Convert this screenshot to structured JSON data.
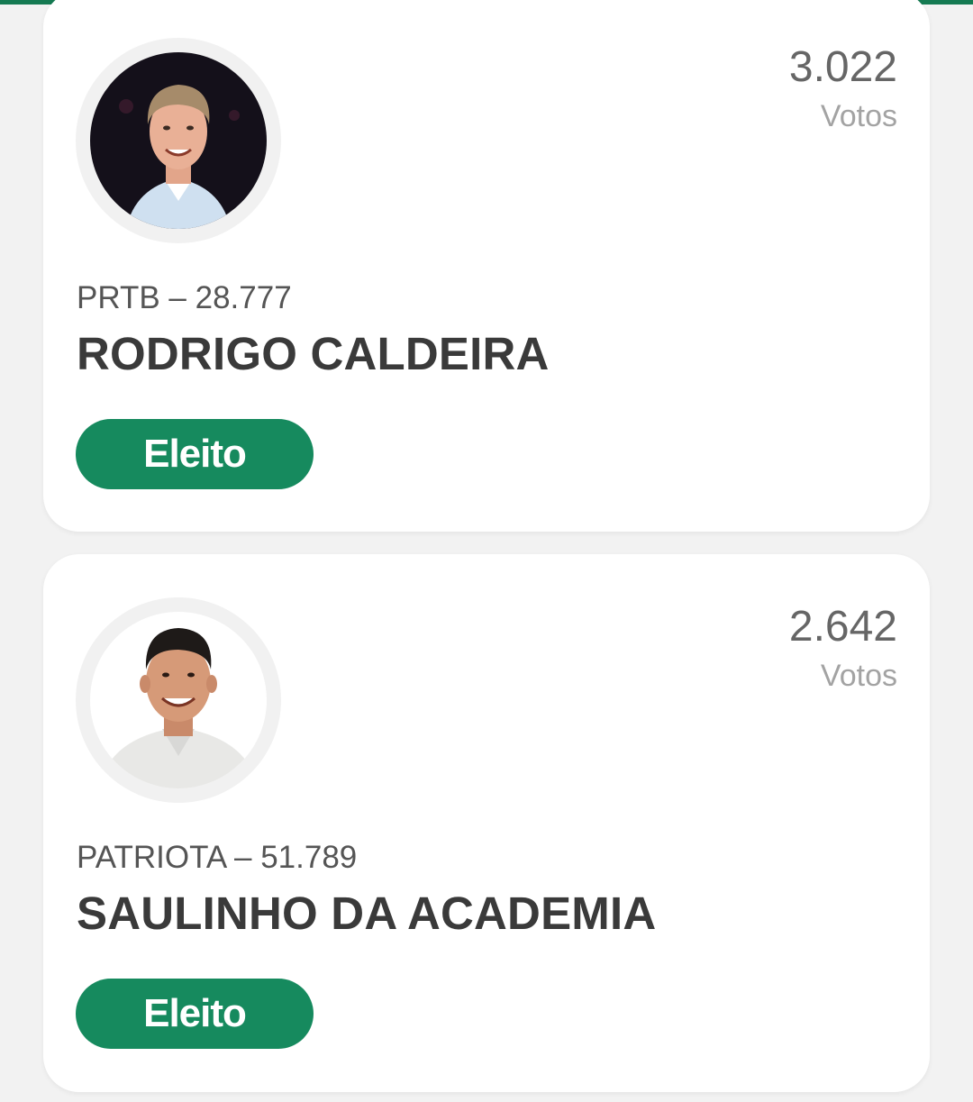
{
  "candidates": [
    {
      "votes": "3.022",
      "votes_label": "Votos",
      "party_line": "PRTB – 28.777",
      "name": "RODRIGO CALDEIRA",
      "status": "Eleito"
    },
    {
      "votes": "2.642",
      "votes_label": "Votos",
      "party_line": "PATRIOTA – 51.789",
      "name": "SAULINHO DA ACADEMIA",
      "status": "Eleito"
    }
  ],
  "colors": {
    "accent": "#157a52",
    "status_bg": "#168a5e",
    "card_bg": "#ffffff",
    "page_bg": "#f2f2f2"
  }
}
